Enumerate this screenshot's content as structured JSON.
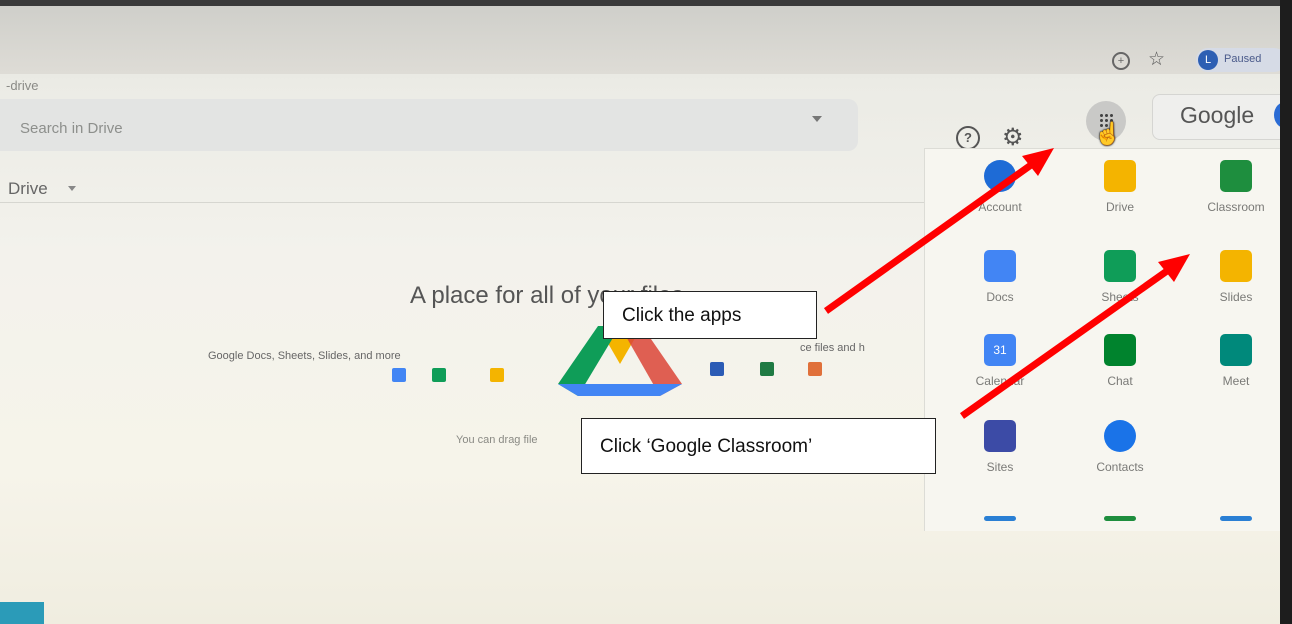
{
  "browser": {
    "url_fragment": "-drive",
    "profile_label": "Paused",
    "profile_initial": "L"
  },
  "toolbar": {
    "search_placeholder": "Search in Drive",
    "google_text": "Google",
    "help_icon": "question-circle-icon",
    "settings_icon": "gear-icon",
    "apps_icon": "grid-icon"
  },
  "sidebar": {
    "drive_title": "Drive"
  },
  "empty_state": {
    "title": "A place for all of your files",
    "docs_caption": "Google Docs, Sheets, Slides, and more",
    "office_caption": "ce files and h",
    "drag_caption": "You can drag file"
  },
  "apps_panel": {
    "apps": [
      {
        "label": "Account",
        "color": "#1e6bd6",
        "icon": "account-icon"
      },
      {
        "label": "Drive",
        "color": "#f4b400",
        "icon": "drive-icon"
      },
      {
        "label": "Classroom",
        "color": "#1e8e3e",
        "icon": "classroom-icon"
      },
      {
        "label": "Docs",
        "color": "#4285f4",
        "icon": "docs-icon"
      },
      {
        "label": "Sheets",
        "color": "#0f9d58",
        "icon": "sheets-icon"
      },
      {
        "label": "Slides",
        "color": "#f4b400",
        "icon": "slides-icon"
      },
      {
        "label": "Calendar",
        "color": "#4285f4",
        "icon": "calendar-icon"
      },
      {
        "label": "Chat",
        "color": "#00832d",
        "icon": "chat-icon"
      },
      {
        "label": "Meet",
        "color": "#00897b",
        "icon": "meet-icon"
      },
      {
        "label": "Sites",
        "color": "#3c4ba6",
        "icon": "sites-icon"
      },
      {
        "label": "Contacts",
        "color": "#1a73e8",
        "icon": "contacts-icon"
      }
    ],
    "calendar_day": "31"
  },
  "annotations": {
    "click_apps": "Click the apps",
    "click_classroom": "Click ‘Google Classroom’",
    "arrow_color": "#ff0000"
  }
}
